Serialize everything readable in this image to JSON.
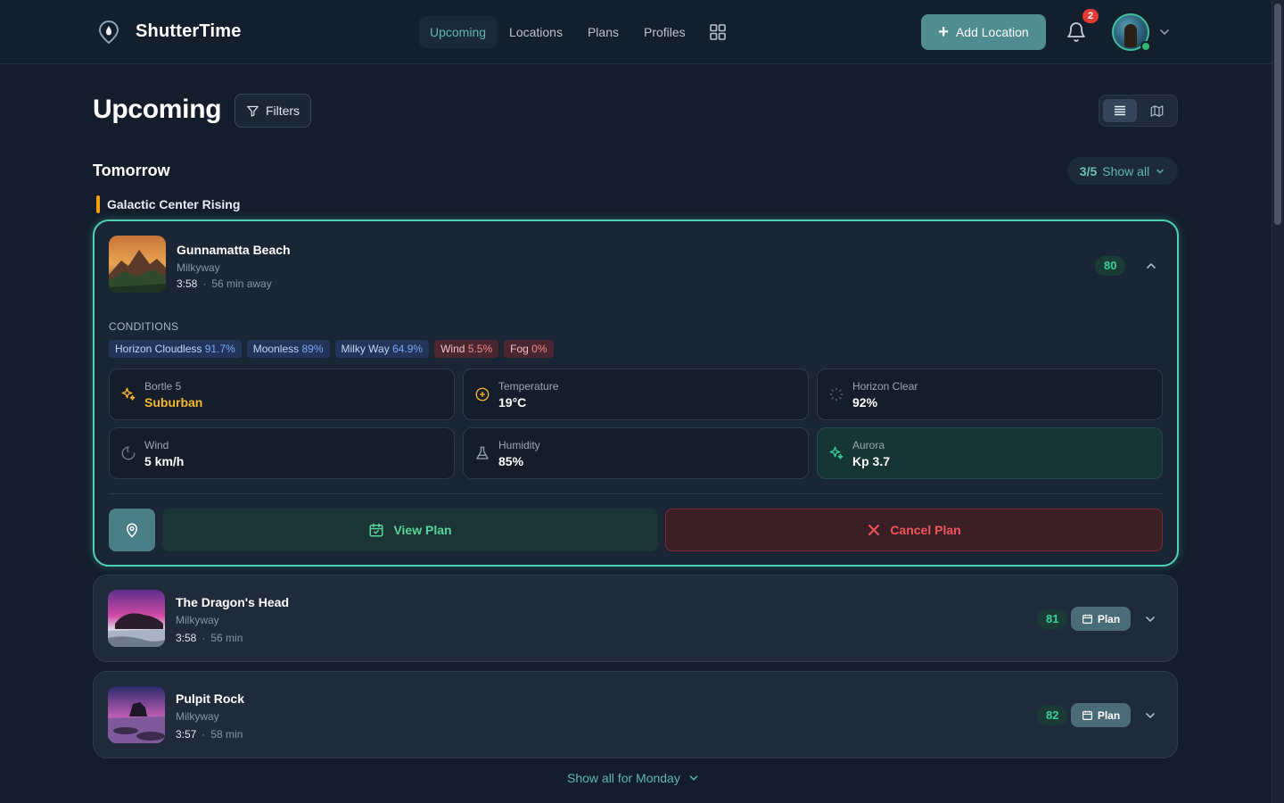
{
  "header": {
    "brand": "ShutterTime",
    "nav": [
      {
        "label": "Upcoming",
        "active": true
      },
      {
        "label": "Locations"
      },
      {
        "label": "Plans"
      },
      {
        "label": "Profiles"
      }
    ],
    "add_location_label": "Add Location",
    "notification_count": "2"
  },
  "page": {
    "title": "Upcoming",
    "filters_label": "Filters"
  },
  "section": {
    "title": "Tomorrow",
    "count": "3/5",
    "show_all_label": "Show all",
    "group_label": "Galactic Center Rising",
    "group_color": "#f59e0b"
  },
  "expanded_card": {
    "name": "Gunnamatta Beach",
    "type": "Milkyway",
    "time": "3:58",
    "separator": "·",
    "away": "56 min away",
    "score": "80",
    "conditions_label": "CONDITIONS",
    "chips": [
      {
        "label": "Horizon Cloudless",
        "value": "91.7%"
      },
      {
        "label": "Moonless",
        "value": "89%"
      },
      {
        "label": "Milky Way",
        "value": "64.9%"
      },
      {
        "label": "Wind",
        "value": "5.5%"
      },
      {
        "label": "Fog",
        "value": "0%"
      }
    ],
    "metrics": [
      {
        "label": "Bortle 5",
        "value": "Suburban",
        "icon": "sparkles-icon"
      },
      {
        "label": "Temperature",
        "value": "19°C",
        "icon": "sun-icon"
      },
      {
        "label": "Horizon Clear",
        "value": "92%",
        "icon": "loader-icon"
      },
      {
        "label": "Wind",
        "value": "5 km/h",
        "icon": "wind-icon"
      },
      {
        "label": "Humidity",
        "value": "85%",
        "icon": "flask-icon"
      },
      {
        "label": "Aurora",
        "value": "Kp 3.7",
        "icon": "sparkles-icon"
      }
    ],
    "view_plan_label": "View Plan",
    "cancel_plan_label": "Cancel Plan"
  },
  "collapsed_cards": [
    {
      "name": "The Dragon's Head",
      "type": "Milkyway",
      "time": "3:58",
      "separator": "·",
      "away": "56 min",
      "score": "81",
      "plan_label": "Plan"
    },
    {
      "name": "Pulpit Rock",
      "type": "Milkyway",
      "time": "3:57",
      "separator": "·",
      "away": "58 min",
      "score": "82",
      "plan_label": "Plan"
    }
  ],
  "footer": {
    "show_monday_label": "Show all for Monday"
  },
  "colors": {
    "accent": "#5fb8ad",
    "score_green": "#39d098",
    "cancel_red": "#f2545b",
    "card_border": "#4fd2b0"
  }
}
